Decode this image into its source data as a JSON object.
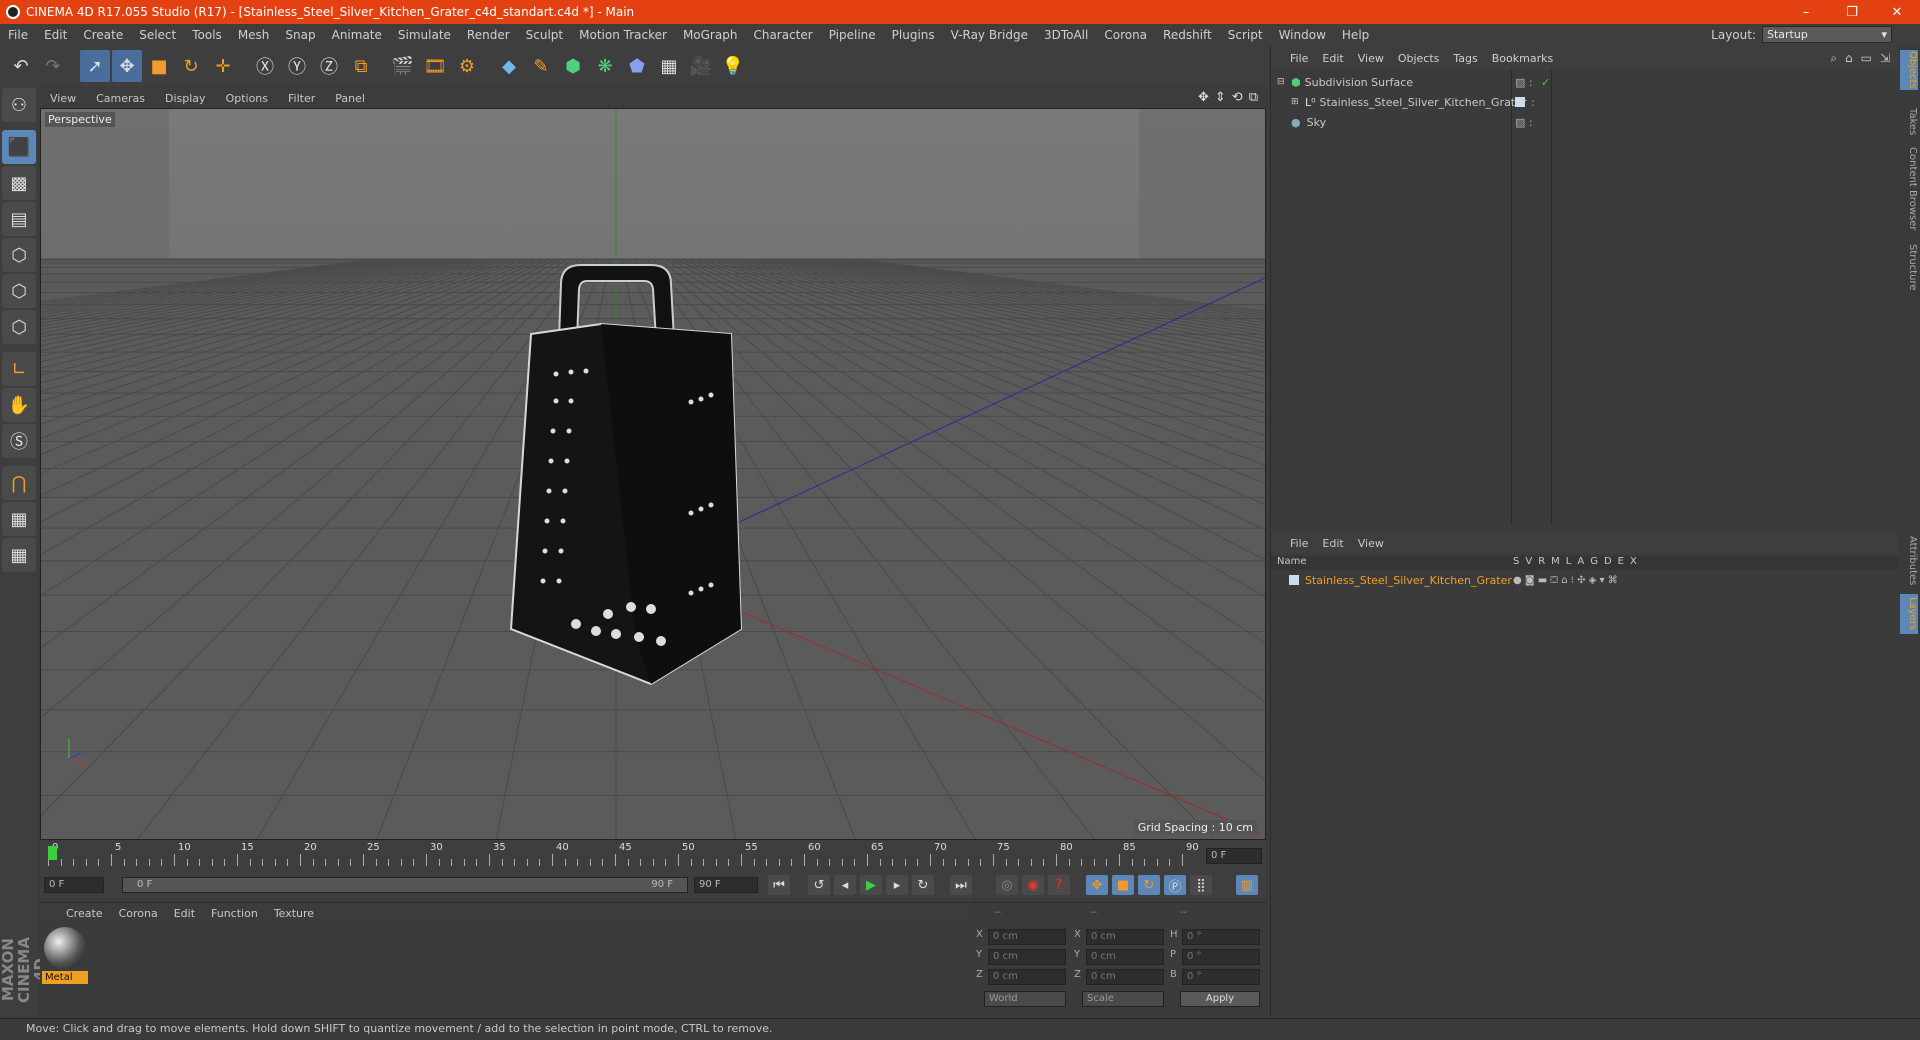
{
  "title": "CINEMA 4D R17.055 Studio (R17) - [Stainless_Steel_Silver_Kitchen_Grater_c4d_standart.c4d *] - Main",
  "menu": [
    "File",
    "Edit",
    "Create",
    "Select",
    "Tools",
    "Mesh",
    "Snap",
    "Animate",
    "Simulate",
    "Render",
    "Sculpt",
    "Motion Tracker",
    "MoGraph",
    "Character",
    "Pipeline",
    "Plugins",
    "V-Ray Bridge",
    "3DToAll",
    "Corona",
    "Redshift",
    "Script",
    "Window",
    "Help"
  ],
  "layout": {
    "label": "Layout:",
    "value": "Startup"
  },
  "viewport": {
    "menu": [
      "View",
      "Cameras",
      "Display",
      "Options",
      "Filter",
      "Panel"
    ],
    "label": "Perspective",
    "grid_spacing": "Grid Spacing : 10 cm"
  },
  "timeline": {
    "ticks": [
      "0",
      "5",
      "10",
      "15",
      "20",
      "25",
      "30",
      "35",
      "40",
      "45",
      "50",
      "55",
      "60",
      "65",
      "70",
      "75",
      "80",
      "85",
      "90"
    ],
    "current": "0 F",
    "start": "0 F",
    "range_start": "0 F",
    "range_end": "90 F",
    "end": "90 F"
  },
  "material": {
    "menu": [
      "Create",
      "Corona",
      "Edit",
      "Function",
      "Texture"
    ],
    "name": "Metal"
  },
  "coords": {
    "headers": [
      "--",
      "--",
      "--"
    ],
    "rows": [
      [
        "X",
        "0 cm",
        "X",
        "0 cm",
        "H",
        "0 °"
      ],
      [
        "Y",
        "0 cm",
        "Y",
        "0 cm",
        "P",
        "0 °"
      ],
      [
        "Z",
        "0 cm",
        "Z",
        "0 cm",
        "B",
        "0 °"
      ]
    ],
    "world": "World",
    "scale": "Scale",
    "apply": "Apply"
  },
  "objects": {
    "menu": [
      "File",
      "Edit",
      "View",
      "Objects",
      "Tags",
      "Bookmarks"
    ],
    "items": [
      "Subdivision Surface",
      "Stainless_Steel_Silver_Kitchen_Grater",
      "Sky"
    ]
  },
  "layers": {
    "menu": [
      "File",
      "Edit",
      "View"
    ],
    "name_header": "Name",
    "cols": [
      "S",
      "V",
      "R",
      "M",
      "L",
      "A",
      "G",
      "D",
      "E",
      "X"
    ],
    "item": "Stainless_Steel_Silver_Kitchen_Grater"
  },
  "right_tabs": [
    "Objects",
    "Takes",
    "Content Browser",
    "Structure",
    "Attributes",
    "Layers"
  ],
  "maxon": "MAXON CINEMA 4D",
  "status": "Move: Click and drag to move elements. Hold down SHIFT to quantize movement / add to the selection in point mode, CTRL to remove.",
  "colors": {
    "title_bar": "#e34112",
    "selected_layer": "#f0a020"
  }
}
